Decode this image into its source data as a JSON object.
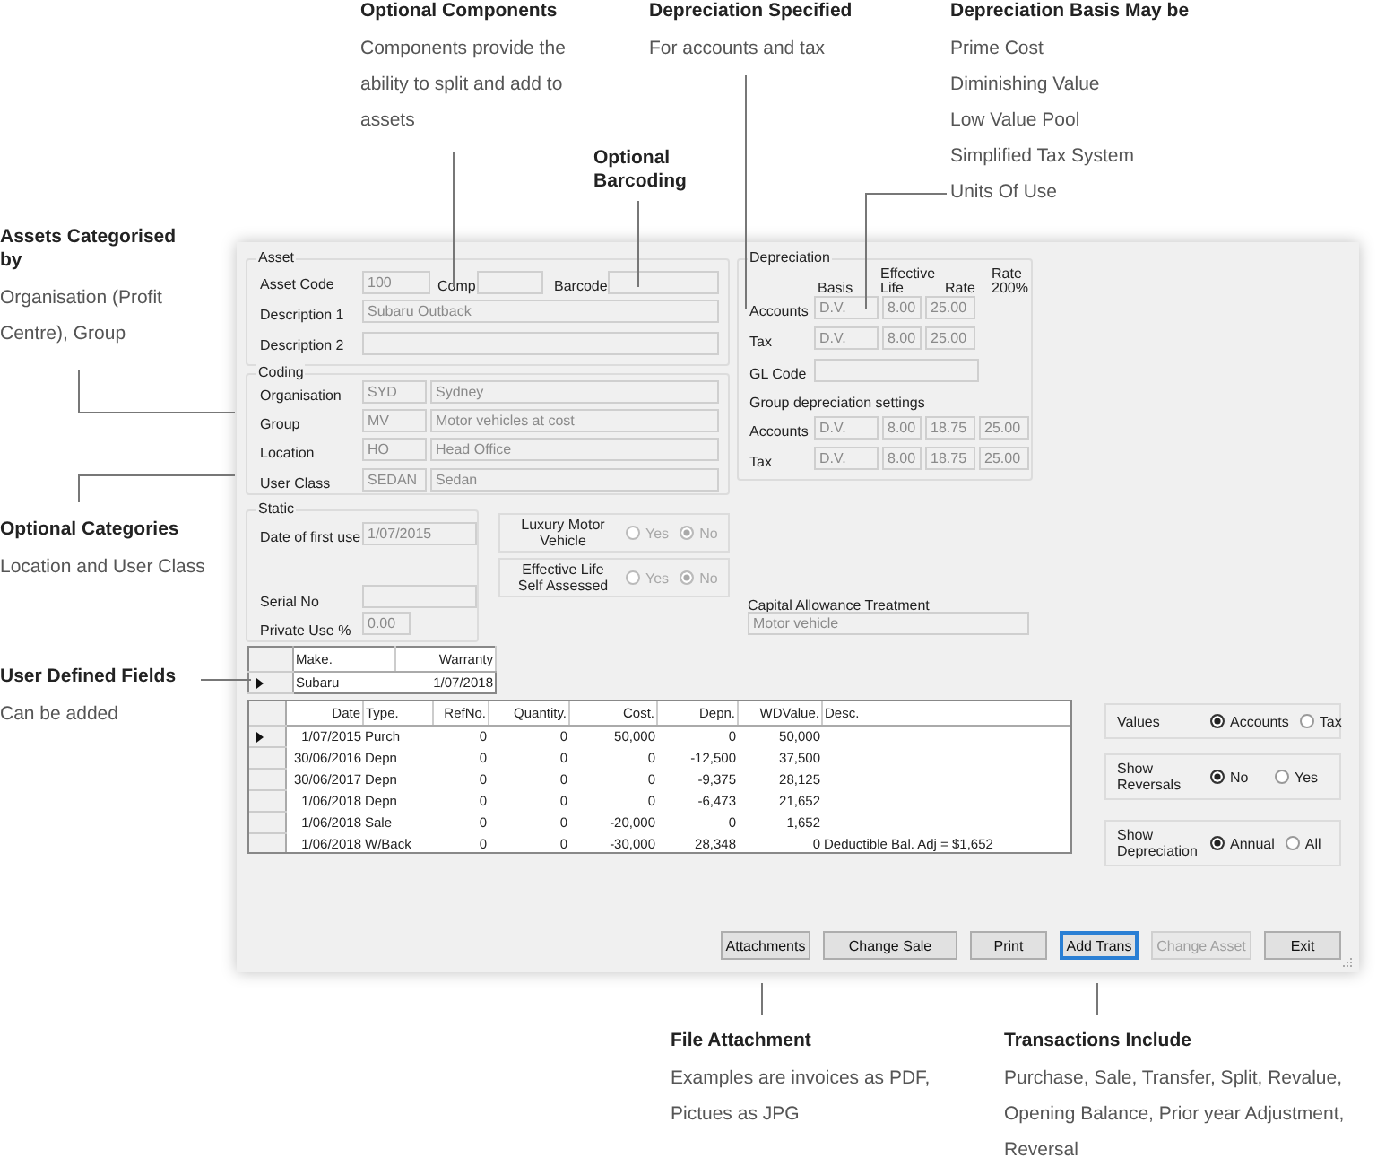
{
  "annotations": [
    {
      "title": "Optional Components",
      "lines": [
        "Components provide the ability to split and add to assets"
      ]
    },
    {
      "title": "Optional Barcoding"
    },
    {
      "title": "Depreciation Specified",
      "lines": [
        "For accounts and tax"
      ]
    },
    {
      "title": "Depreciation Basis May be",
      "lines": [
        "Prime Cost",
        "Diminishing Value",
        "Low Value Pool",
        "Simplified Tax System",
        "Units Of Use"
      ]
    },
    {
      "title": "Assets Categorised by",
      "lines": [
        "Organisation (Profit Centre), Group"
      ]
    },
    {
      "title": "Optional Categories",
      "lines": [
        "Location and User Class"
      ]
    },
    {
      "title": "User Defined Fields",
      "lines": [
        "Can be added"
      ]
    },
    {
      "title": "File Attachment",
      "lines": [
        "Examples are invoices as PDF, Pictues as JPG"
      ]
    },
    {
      "title": "Transactions Include",
      "lines": [
        "Purchase, Sale, Transfer, Split, Revalue, Opening Balance, Prior year Adjustment, Reversal"
      ]
    }
  ],
  "asset_group": {
    "title": "Asset",
    "asset_code": {
      "label": "Asset Code",
      "value": "100"
    },
    "comp": {
      "label": "Comp"
    },
    "barcode": {
      "label": "Barcode"
    },
    "description_1": {
      "label": "Description 1",
      "value": "Subaru Outback"
    },
    "description_2": {
      "label": "Description 2"
    }
  },
  "coding_group": {
    "title": "Coding",
    "rows": [
      {
        "label": "Organisation",
        "code": "SYD",
        "name": "Sydney"
      },
      {
        "label": "Group",
        "code": "MV",
        "name": "Motor vehicles at cost"
      },
      {
        "label": "Location",
        "code": "HO",
        "name": "Head Office"
      },
      {
        "label": "User Class",
        "code": "SEDAN",
        "name": "Sedan"
      }
    ]
  },
  "depreciation_group": {
    "title": "Depreciation",
    "headers": [
      "Basis",
      "Effective Life",
      "Rate",
      "Rate 200%"
    ],
    "rows": [
      {
        "label": "Accounts",
        "values": [
          "D.V.",
          "8.00",
          "25.00"
        ]
      },
      {
        "label": "Tax",
        "values": [
          "D.V.",
          "8.00",
          "25.00"
        ]
      }
    ],
    "gl_code": {
      "label": "GL Code"
    },
    "group_settings": {
      "title": "Group depreciation settings",
      "rows": [
        {
          "label": "Accounts",
          "values": [
            "D.V.",
            "8.00",
            "18.75",
            "25.00"
          ]
        },
        {
          "label": "Tax",
          "values": [
            "D.V.",
            "8.00",
            "18.75",
            "25.00"
          ]
        }
      ]
    }
  },
  "static_group": {
    "title": "Static",
    "fields": [
      {
        "label": "Date of first use",
        "value": "1/07/2015"
      },
      {
        "label": "Serial No"
      },
      {
        "label": "Private Use %",
        "value": "0.00"
      }
    ]
  },
  "yes_no_options": [
    {
      "label": "Luxury Motor Vehicle",
      "disabled": true,
      "options": [
        {
          "label": "Yes",
          "selected": false
        },
        {
          "label": "No",
          "selected": true
        }
      ]
    },
    {
      "label": "Effective Life Self Assessed",
      "disabled": true,
      "options": [
        {
          "label": "Yes",
          "selected": false
        },
        {
          "label": "No",
          "selected": true
        }
      ]
    }
  ],
  "capital_allowance": {
    "label": "Capital Allowance Treatment",
    "value": "Motor vehicle"
  },
  "user_fields": {
    "columns": [
      "Make.",
      "Warranty"
    ],
    "rows": [
      {
        "current": true,
        "cells": [
          "Subaru",
          "1/07/2018"
        ]
      }
    ]
  },
  "transactions": {
    "columns": [
      "Date",
      "Type.",
      "RefNo.",
      "Quantity.",
      "Cost.",
      "Depn.",
      "WDValue.",
      "Desc."
    ],
    "rows": [
      {
        "current": true,
        "cells": [
          "1/07/2015",
          "Purch",
          "0",
          "0",
          "50,000",
          "0",
          "50,000"
        ]
      },
      {
        "current": false,
        "cells": [
          "30/06/2016",
          "Depn",
          "0",
          "0",
          "0",
          "-12,500",
          "37,500"
        ]
      },
      {
        "current": false,
        "cells": [
          "30/06/2017",
          "Depn",
          "0",
          "0",
          "0",
          "-9,375",
          "28,125"
        ]
      },
      {
        "current": false,
        "cells": [
          "1/06/2018",
          "Depn",
          "0",
          "0",
          "0",
          "-6,473",
          "21,652"
        ]
      },
      {
        "current": false,
        "cells": [
          "1/06/2018",
          "Sale",
          "0",
          "0",
          "-20,000",
          "0",
          "1,652"
        ]
      },
      {
        "current": false,
        "cells": [
          "1/06/2018",
          "W/Back",
          "0",
          "0",
          "-30,000",
          "28,348",
          "0",
          "Deductible Bal. Adj = $1,652"
        ]
      }
    ]
  },
  "view_options": [
    {
      "label": "Values",
      "options": [
        {
          "label": "Accounts",
          "selected": true
        },
        {
          "label": "Tax",
          "selected": false
        }
      ]
    },
    {
      "label": "Show Reversals",
      "options": [
        {
          "label": "No",
          "selected": true
        },
        {
          "label": "Yes",
          "selected": false
        }
      ]
    },
    {
      "label": "Show Depreciation",
      "options": [
        {
          "label": "Annual",
          "selected": true
        },
        {
          "label": "All",
          "selected": false
        }
      ]
    }
  ],
  "buttons": [
    {
      "label": "Attachments",
      "focused": false,
      "disabled": false
    },
    {
      "label": "Change Sale",
      "focused": false,
      "disabled": false
    },
    {
      "label": "Print",
      "focused": false,
      "disabled": false
    },
    {
      "label": "Add Trans",
      "focused": true,
      "disabled": false
    },
    {
      "label": "Change Asset",
      "focused": false,
      "disabled": true
    },
    {
      "label": "Exit",
      "focused": false,
      "disabled": false
    }
  ]
}
